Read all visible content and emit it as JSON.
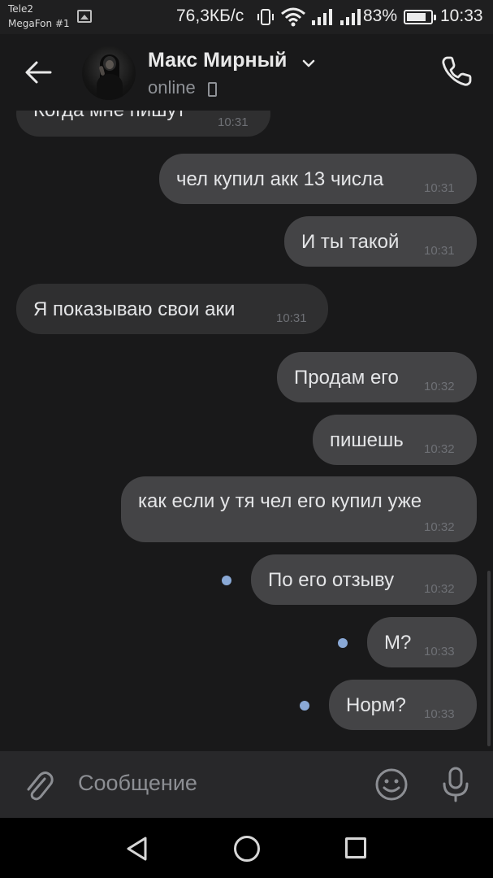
{
  "status_bar": {
    "carrier_1": "Tele2",
    "carrier_2": "MegaFon #1",
    "speed": "76,3КБ/с",
    "battery_percent": "83%",
    "battery_level": 0.83,
    "time": "10:33"
  },
  "header": {
    "contact_name": "Макс Мирный",
    "status": "online"
  },
  "messages": [
    {
      "text": "Когда мне пишут",
      "time": "10:31",
      "direction": "in"
    },
    {
      "text": "чел купил акк 13 числа",
      "time": "10:31",
      "direction": "out"
    },
    {
      "text": "И ты такой",
      "time": "10:31",
      "direction": "out"
    },
    {
      "text": "Я показываю свои аки",
      "time": "10:31",
      "direction": "in"
    },
    {
      "text": "Продам его",
      "time": "10:32",
      "direction": "out"
    },
    {
      "text": "пишешь",
      "time": "10:32",
      "direction": "out"
    },
    {
      "text": "как если у тя чел его купил уже",
      "time": "10:32",
      "direction": "out"
    },
    {
      "text": "По его отзыву",
      "time": "10:32",
      "direction": "out",
      "unread": true
    },
    {
      "text": "М?",
      "time": "10:33",
      "direction": "out",
      "unread": true
    },
    {
      "text": "Норм?",
      "time": "10:33",
      "direction": "out",
      "unread": true
    }
  ],
  "composer": {
    "placeholder": "Сообщение"
  },
  "icons": {
    "back": "arrow-left-icon",
    "call": "phone-icon",
    "attach": "paperclip-icon",
    "emoji": "smiley-icon",
    "mic": "microphone-icon"
  },
  "colors": {
    "background": "#19191a",
    "bubble_in": "#2f2f30",
    "bubble_out": "#444446",
    "unread_dot": "#8aa9d6"
  }
}
